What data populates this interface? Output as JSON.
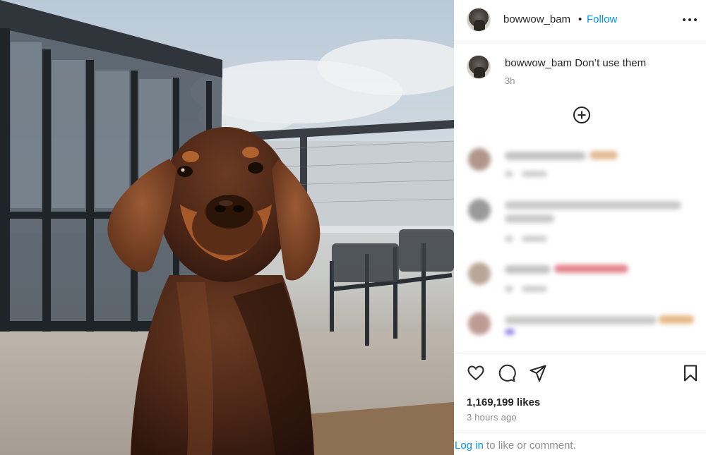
{
  "post": {
    "username": "bowwow_bam",
    "separator": "•",
    "follow_label": "Follow",
    "more_icon": "more-horizontal-icon"
  },
  "caption": {
    "username": "bowwow_bam",
    "text": "Don’t use them",
    "time": "3h"
  },
  "comments": {
    "load_more_icon": "plus-circle-icon"
  },
  "actions": {
    "like_icon": "heart-icon",
    "comment_icon": "comment-icon",
    "share_icon": "send-icon",
    "save_icon": "bookmark-icon",
    "likes": "1,169,199 likes",
    "posted_ago": "3 hours ago"
  },
  "login": {
    "link_label": "Log in",
    "rest": " to like or comment."
  },
  "colors": {
    "link_blue": "#0095f6",
    "text": "#262626",
    "muted": "#8e8e8e"
  }
}
